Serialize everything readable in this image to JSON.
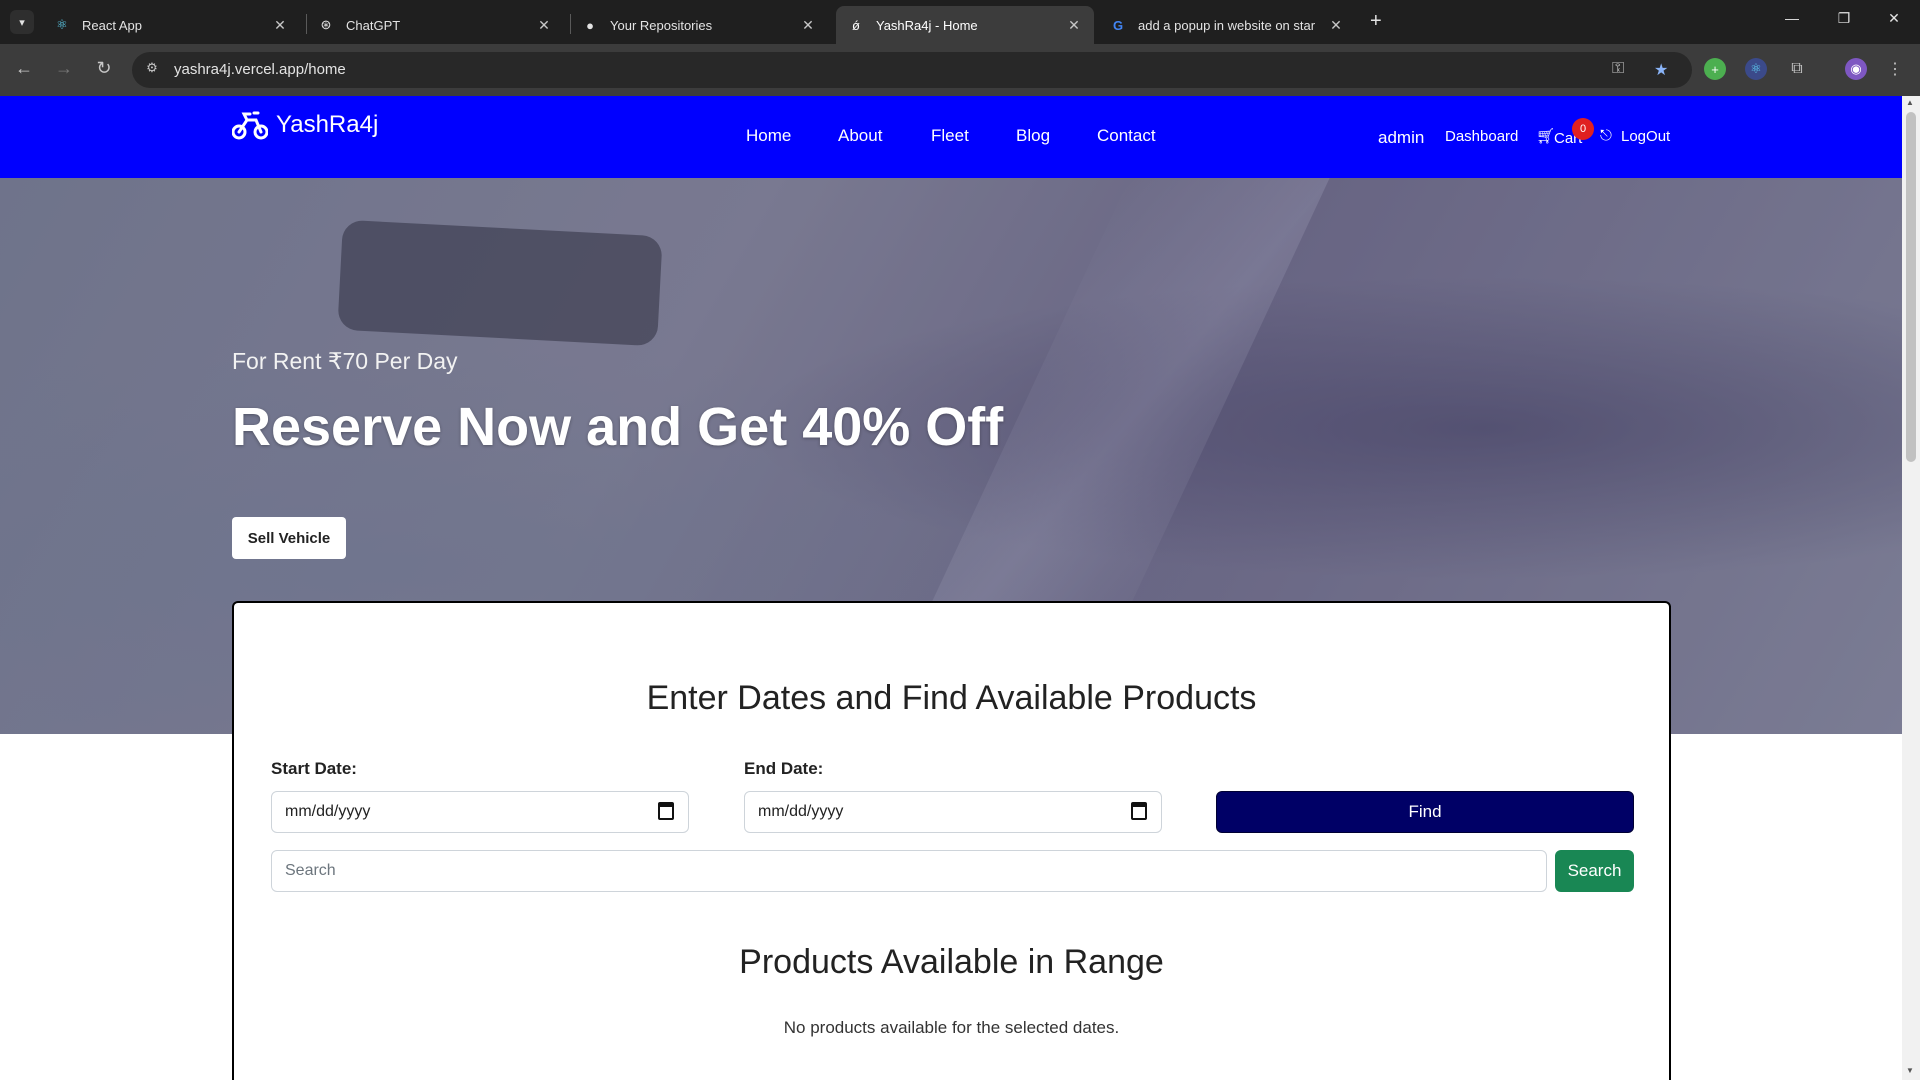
{
  "browser": {
    "tabs": [
      {
        "title": "React App",
        "icon": "react-icon"
      },
      {
        "title": "ChatGPT",
        "icon": "chatgpt-icon"
      },
      {
        "title": "Your Repositories",
        "icon": "github-icon"
      },
      {
        "title": "YashRa4j - Home",
        "icon": "bike-icon",
        "active": true
      },
      {
        "title": "add a popup in website on star",
        "icon": "google-icon"
      }
    ],
    "url": "yashra4j.vercel.app/home"
  },
  "header": {
    "brand": "YashRa4j",
    "nav": [
      "Home",
      "About",
      "Fleet",
      "Blog",
      "Contact"
    ],
    "user": "admin",
    "dashboard": "Dashboard",
    "cart": "Cart",
    "cart_count": "0",
    "logout": "LogOut"
  },
  "hero": {
    "subtitle": "For Rent ₹70 Per Day",
    "title": "Reserve Now and Get 40% Off",
    "button": "Sell Vehicle"
  },
  "finder": {
    "heading": "Enter Dates and Find Available Products",
    "start_label": "Start Date:",
    "end_label": "End Date:",
    "date_placeholder": "mm/dd/yyyy",
    "find": "Find",
    "search_placeholder": "Search",
    "search_button": "Search",
    "results_heading": "Products Available in Range",
    "empty_message": "No products available for the selected dates."
  },
  "colors": {
    "header_bg": "#0000ff",
    "find_btn": "#000066",
    "search_btn": "#198754",
    "badge": "#e02020"
  }
}
